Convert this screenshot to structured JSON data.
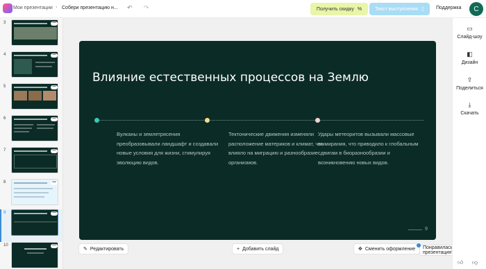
{
  "topbar": {
    "breadcrumb_root": "Мои презентации",
    "breadcrumb_current": "Собери презентацию н...",
    "discount_label": "Получить скидку",
    "speech_label": "Текст выступления",
    "support_label": "Поддержка",
    "avatar_letter": "C"
  },
  "thumbnails": [
    {
      "num": "3"
    },
    {
      "num": "4"
    },
    {
      "num": "5"
    },
    {
      "num": "6"
    },
    {
      "num": "7"
    },
    {
      "num": "8"
    },
    {
      "num": "9"
    },
    {
      "num": "10"
    }
  ],
  "slide": {
    "title": "Влияние естественных процессов на Землю",
    "columns": [
      {
        "text": "Вулканы и землетрясения преобразовывали ландшафт и создавали новые условия для жизни, стимулируя эволюцию видов.",
        "dot_color": "#3ec6b4"
      },
      {
        "text": "Тектонические движения изменяли расположение материков и климат, что влияло на миграцию и разнообразие организмов.",
        "dot_color": "#f3dc8a"
      },
      {
        "text": "Удары метеоритов вызывали массовые вымирания, что приводило к глобальным сдвигам в биоразнообразии и возникновению новых видов.",
        "dot_color": "#f1d2d2"
      }
    ],
    "page_number": "9"
  },
  "bottom": {
    "edit_label": "Редактировать",
    "add_slide_label": "Добавить слайд",
    "change_design_label": "Сменить оформление",
    "feedback_label": "Понравилась презентация?"
  },
  "rail": {
    "slideshow_label": "Слайд-шоу",
    "design_label": "Дизайн",
    "share_label": "Поделиться",
    "download_label": "Скачать"
  },
  "colors": {
    "slide_bg": "#0b2b26",
    "accent": "#3a8bd6"
  }
}
